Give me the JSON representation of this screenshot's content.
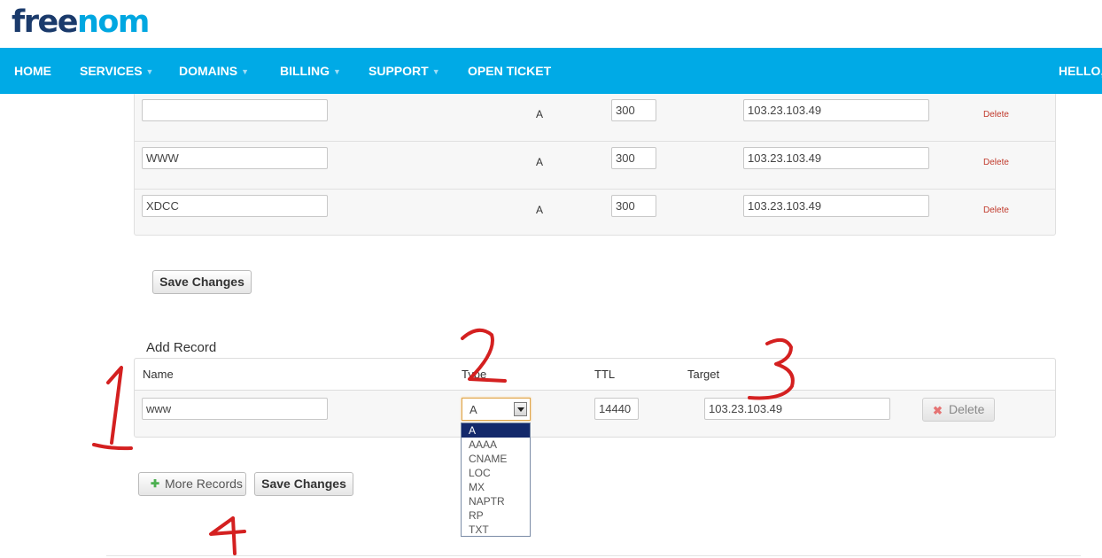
{
  "logo": {
    "part1": "free",
    "part2": "nom"
  },
  "nav": {
    "items": [
      {
        "label": "HOME",
        "dropdown": false
      },
      {
        "label": "SERVICES",
        "dropdown": true
      },
      {
        "label": "DOMAINS",
        "dropdown": true
      },
      {
        "label": "BILLING",
        "dropdown": true
      },
      {
        "label": "SUPPORT",
        "dropdown": true
      },
      {
        "label": "OPEN TICKET",
        "dropdown": false
      }
    ],
    "hello": "HELLO,",
    "caret": "▼"
  },
  "records": [
    {
      "name": "",
      "type": "A",
      "ttl": "300",
      "target": "103.23.103.49",
      "delete": "Delete"
    },
    {
      "name": "WWW",
      "type": "A",
      "ttl": "300",
      "target": "103.23.103.49",
      "delete": "Delete"
    },
    {
      "name": "XDCC",
      "type": "A",
      "ttl": "300",
      "target": "103.23.103.49",
      "delete": "Delete"
    }
  ],
  "save_changes": "Save Changes",
  "add_record": {
    "title": "Add Record",
    "columns": {
      "name": "Name",
      "type": "Type",
      "ttl": "TTL",
      "target": "Target"
    },
    "row": {
      "name": "www",
      "type": "A",
      "ttl": "14440",
      "target": "103.23.103.49",
      "delete": "Delete"
    },
    "type_options": [
      "A",
      "AAAA",
      "CNAME",
      "LOC",
      "MX",
      "NAPTR",
      "RP",
      "TXT"
    ],
    "selected_option": "A"
  },
  "more_records": "More Records",
  "icons": {
    "plus": "plus-icon",
    "delete": "x-icon"
  },
  "annotations": [
    "1",
    "2",
    "3",
    "4"
  ],
  "colors": {
    "nav_bg": "#00aae6",
    "logo_dark": "#1a3a6b",
    "logo_blue": "#00a7e1",
    "annotation": "#d42020",
    "delete_link": "#c0392b"
  }
}
